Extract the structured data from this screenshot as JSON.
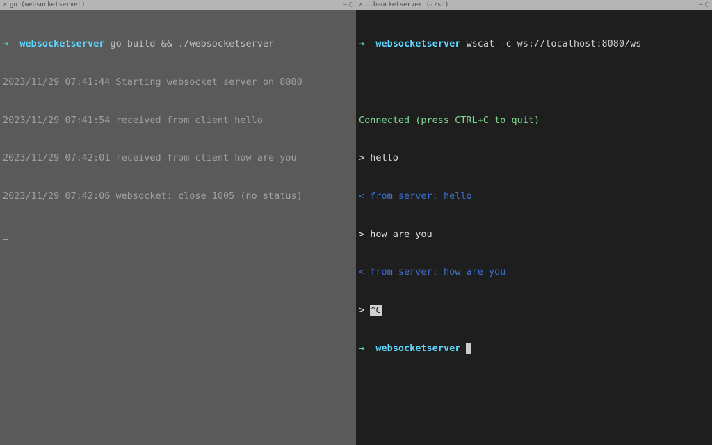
{
  "left": {
    "titlebar": {
      "close_icon": "×",
      "title": "go (websocketserver)",
      "min_icon": "—",
      "circle_icon": "◯"
    },
    "prompt": {
      "arrow": "→",
      "cwd": "websocketserver",
      "command": "go build && ./websocketserver"
    },
    "logs": [
      "2023/11/29 07:41:44 Starting websocket server on 8080",
      "2023/11/29 07:41:54 received from client hello",
      "2023/11/29 07:42:01 received from client how are you",
      "2023/11/29 07:42:06 websocket: close 1005 (no status)"
    ]
  },
  "right": {
    "titlebar": {
      "close_icon": "×",
      "title": "..bsocketserver (-zsh)",
      "min_icon": "—",
      "circle_icon": "◯"
    },
    "prompt1": {
      "arrow": "→",
      "cwd": "websocketserver",
      "command": "wscat -c ws://localhost:8080/ws"
    },
    "connected": "Connected (press CTRL+C to quit)",
    "io": [
      {
        "prefix": ">",
        "text": "hello",
        "style": "white"
      },
      {
        "prefix": "<",
        "text": "from server: hello",
        "style": "blue"
      },
      {
        "prefix": ">",
        "text": "how are you",
        "style": "white"
      },
      {
        "prefix": "<",
        "text": "from server: how are you",
        "style": "blue"
      },
      {
        "prefix": ">",
        "text": "",
        "style": "white"
      }
    ],
    "ctrl": "^C",
    "prompt2": {
      "arrow": "→",
      "cwd": "websocketserver"
    }
  }
}
